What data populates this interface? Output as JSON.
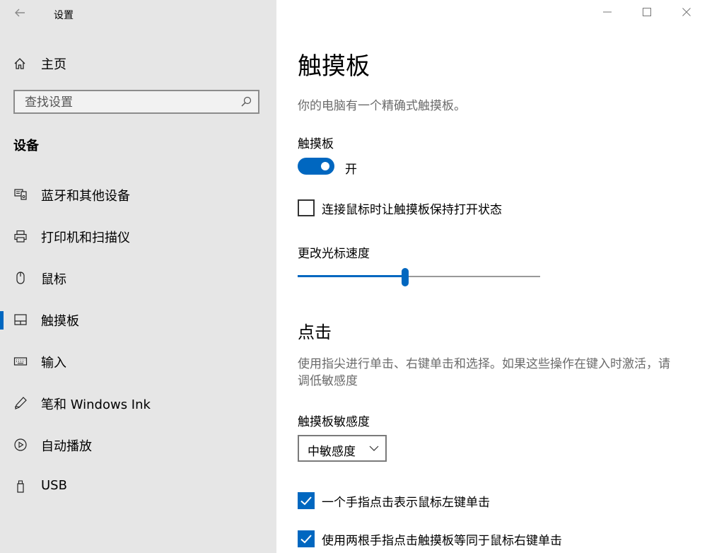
{
  "window": {
    "app_title": "设置",
    "back_icon": "arrow-left-icon",
    "minimize_icon": "minimize-icon",
    "maximize_icon": "maximize-icon",
    "close_icon": "close-icon"
  },
  "sidebar": {
    "home_label": "主页",
    "search_placeholder": "查找设置",
    "section_title": "设备",
    "items": [
      {
        "label": "蓝牙和其他设备",
        "icon": "bluetooth-devices-icon"
      },
      {
        "label": "打印机和扫描仪",
        "icon": "printer-icon"
      },
      {
        "label": "鼠标",
        "icon": "mouse-icon"
      },
      {
        "label": "触摸板",
        "icon": "touchpad-icon",
        "selected": true
      },
      {
        "label": "输入",
        "icon": "keyboard-icon"
      },
      {
        "label": "笔和 Windows Ink",
        "icon": "pen-icon"
      },
      {
        "label": "自动播放",
        "icon": "autoplay-icon"
      },
      {
        "label": "USB",
        "icon": "usb-icon"
      }
    ]
  },
  "main": {
    "title": "触摸板",
    "description": "你的电脑有一个精确式触摸板。",
    "touchpad_label": "触摸板",
    "toggle_state_text": "开",
    "toggle_on": true,
    "keep_on_with_mouse": {
      "label": "连接鼠标时让触摸板保持打开状态",
      "checked": false
    },
    "cursor_speed": {
      "label": "更改光标速度",
      "value_fraction": 0.44
    },
    "taps": {
      "heading": "点击",
      "description": "使用指尖进行单击、右键单击和选择。如果这些操作在键入时激活，请调低敏感度",
      "sensitivity_label": "触摸板敏感度",
      "sensitivity_value": "中敏感度",
      "options": [
        {
          "label": "一个手指点击表示鼠标左键单击",
          "checked": true
        },
        {
          "label": "使用两根手指点击触摸板等同于鼠标右键单击",
          "checked": true
        }
      ]
    }
  },
  "colors": {
    "accent": "#0067c0",
    "sidebar_bg": "#e6e6e6"
  }
}
